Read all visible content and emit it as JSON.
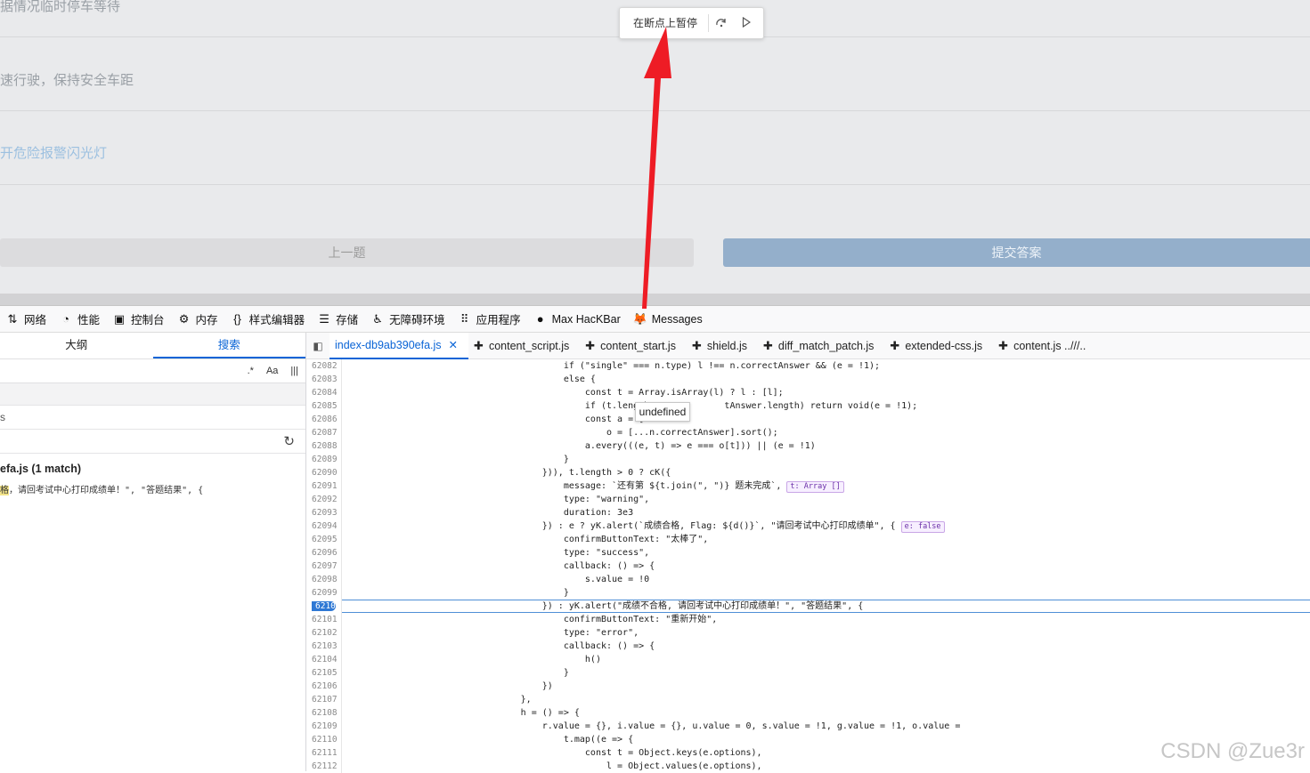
{
  "page": {
    "options": [
      "据情况临时停车等待",
      "速行驶，保持安全车距",
      "开危险报警闪光灯"
    ],
    "prev_button": "上一题",
    "submit_button": "提交答案"
  },
  "debugger_overlay": {
    "label": "在断点上暂停",
    "step_over_icon": "step-over-icon",
    "resume_icon": "resume-icon"
  },
  "devtools_toolbar": [
    {
      "icon": "⇅",
      "label": "网络"
    },
    {
      "icon": "◔",
      "label": "性能"
    },
    {
      "icon": "▣",
      "label": "控制台"
    },
    {
      "icon": "⚙",
      "label": "内存"
    },
    {
      "icon": "{}",
      "label": "样式编辑器"
    },
    {
      "icon": "☰",
      "label": "存储"
    },
    {
      "icon": "♿",
      "label": "无障碍环境"
    },
    {
      "icon": "⠿",
      "label": "应用程序"
    },
    {
      "icon": "●",
      "label": "Max HacKBar"
    },
    {
      "icon": "🦊",
      "label": "Messages"
    }
  ],
  "left_pane": {
    "tabs": [
      "大纲",
      "搜索"
    ],
    "search_toggles": [
      ".*",
      "Aa",
      "|||"
    ],
    "row2_text": "s",
    "refresh_icon": "↻",
    "result_file": "efa.js (1 match)",
    "result_prefix": "",
    "result_hl": "格",
    "result_rest": "，请回考试中心打印成绩单！\", \"答题结果\", {"
  },
  "editor_tabs": [
    {
      "label": "index-db9ab390efa.js",
      "active": true
    },
    {
      "label": "content_script.js",
      "active": false
    },
    {
      "label": "content_start.js",
      "active": false
    },
    {
      "label": "shield.js",
      "active": false
    },
    {
      "label": "diff_match_patch.js",
      "active": false
    },
    {
      "label": "extended-css.js",
      "active": false
    },
    {
      "label": "content.js ..///..",
      "active": false
    }
  ],
  "tooltip": "undefined",
  "code_lines": [
    {
      "n": "62082",
      "text": "                                        if (\"single\" === n.type) l !== n.correctAnswer && (e = !1);"
    },
    {
      "n": "62083",
      "text": "                                        else {"
    },
    {
      "n": "62084",
      "text": "                                            const t = Array.isArray(l) ? l : [l];"
    },
    {
      "n": "62085",
      "text": "                                            if (t.length !            tAnswer.length) return void(e = !1);"
    },
    {
      "n": "62086",
      "text": "                                            const a = [..."
    },
    {
      "n": "62087",
      "text": "                                                o = [...n.correctAnswer].sort();"
    },
    {
      "n": "62088",
      "text": "                                            a.every(((e, t) => e === o[t])) || (e = !1)"
    },
    {
      "n": "62089",
      "text": "                                        }"
    },
    {
      "n": "62090",
      "text": "                                    })), t.length > 0 ? cK({"
    },
    {
      "n": "62091",
      "text": "                                        message: `还有第 ${t.join(\", \")} 题未完成`,",
      "badge": "t: Array []"
    },
    {
      "n": "62092",
      "text": "                                        type: \"warning\","
    },
    {
      "n": "62093",
      "text": "                                        duration: 3e3"
    },
    {
      "n": "62094",
      "text": "                                    }) : e ? yK.alert(`成绩合格, Flag: ${d()}`, \"请回考试中心打印成绩单\", {",
      "badge": "e: false"
    },
    {
      "n": "62095",
      "text": "                                        confirmButtonText: \"太棒了\","
    },
    {
      "n": "62096",
      "text": "                                        type: \"success\","
    },
    {
      "n": "62097",
      "text": "                                        callback: () => {"
    },
    {
      "n": "62098",
      "text": "                                            s.value = !0"
    },
    {
      "n": "62099",
      "text": "                                        }"
    },
    {
      "n": "6210",
      "text": "                                    }) : yK.alert(\"成绩不合格, 请回考试中心打印成绩单！\", \"答题结果\", {",
      "current": true
    },
    {
      "n": "62101",
      "text": "                                        confirmButtonText: \"重新开始\","
    },
    {
      "n": "62102",
      "text": "                                        type: \"error\","
    },
    {
      "n": "62103",
      "text": "                                        callback: () => {"
    },
    {
      "n": "62104",
      "text": "                                            h()"
    },
    {
      "n": "62105",
      "text": "                                        }"
    },
    {
      "n": "62106",
      "text": "                                    })"
    },
    {
      "n": "62107",
      "text": "                                },"
    },
    {
      "n": "62108",
      "text": "                                h = () => {"
    },
    {
      "n": "62109",
      "text": "                                    r.value = {}, i.value = {}, u.value = 0, s.value = !1, g.value = !1, o.value ="
    },
    {
      "n": "62110",
      "text": "                                        t.map((e => {"
    },
    {
      "n": "62111",
      "text": "                                            const t = Object.keys(e.options),"
    },
    {
      "n": "62112",
      "text": "                                                l = Object.values(e.options),"
    }
  ],
  "watermark": "CSDN @Zue3r",
  "colors": {
    "accent": "#0a64d6",
    "arrow": "#ee1c25",
    "submit": "#94afcb"
  }
}
